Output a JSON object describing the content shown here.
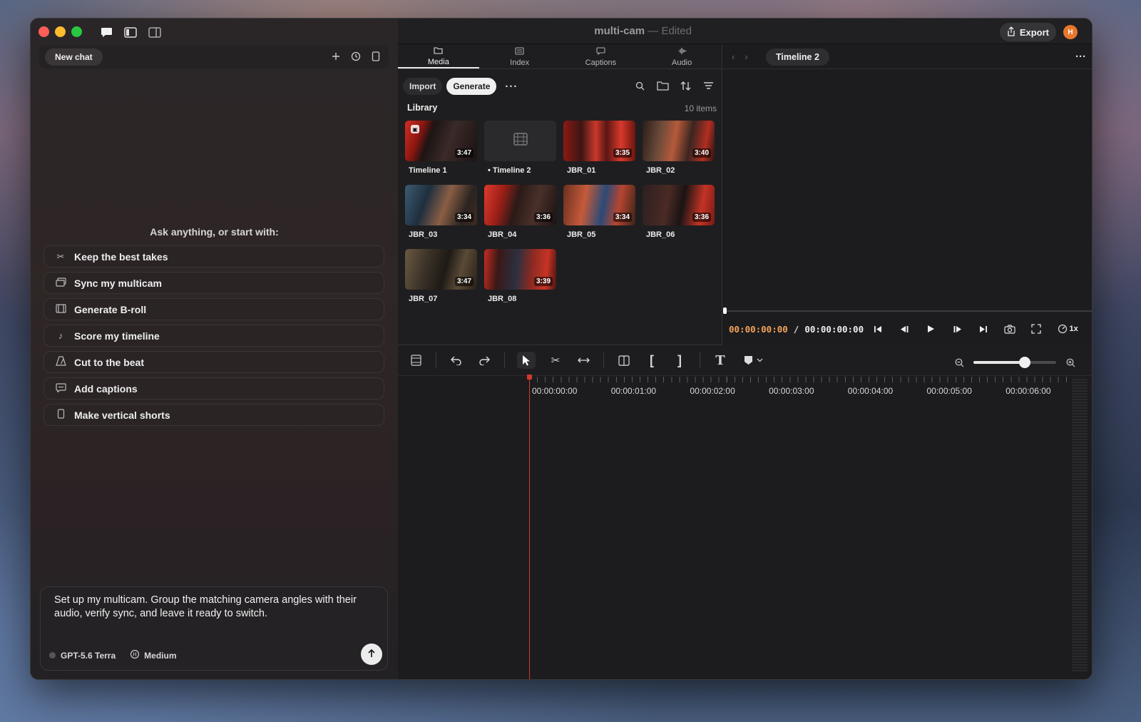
{
  "window": {
    "title": "multi-cam",
    "title_sep": " — ",
    "title_state": "Edited",
    "export_label": "Export",
    "avatar_initial": "H"
  },
  "chat": {
    "new_chat_label": "New chat",
    "prompt_heading": "Ask anything, or start with:",
    "suggestions": [
      {
        "label": "Keep the best takes",
        "icon": "scissors-icon"
      },
      {
        "label": "Sync my multicam",
        "icon": "layers-icon"
      },
      {
        "label": "Generate B-roll",
        "icon": "film-icon"
      },
      {
        "label": "Score my timeline",
        "icon": "music-note-icon"
      },
      {
        "label": "Cut to the beat",
        "icon": "metronome-icon"
      },
      {
        "label": "Add captions",
        "icon": "caption-icon"
      },
      {
        "label": "Make vertical shorts",
        "icon": "phone-icon"
      }
    ],
    "composer_text": "Set up my multicam. Group the matching camera angles with their audio, verify sync, and leave it ready to switch.",
    "model": "GPT-5.6 Terra",
    "effort": "Medium"
  },
  "media": {
    "tabs": [
      {
        "label": "Media",
        "active": true
      },
      {
        "label": "Index",
        "active": false
      },
      {
        "label": "Captions",
        "active": false
      },
      {
        "label": "Audio",
        "active": false
      }
    ],
    "import_label": "Import",
    "generate_label": "Generate",
    "more_label": "···",
    "library_label": "Library",
    "item_count": "10 items",
    "items": [
      {
        "name": "Timeline 1",
        "duration": "3:47",
        "style": "t-red",
        "locked": true
      },
      {
        "name": "• Timeline 2",
        "duration": "",
        "style": "t-blank",
        "locked": false
      },
      {
        "name": "JBR_01",
        "duration": "3:35",
        "style": "t-stage1",
        "locked": false
      },
      {
        "name": "JBR_02",
        "duration": "3:40",
        "style": "t-stage2",
        "locked": false
      },
      {
        "name": "JBR_03",
        "duration": "3:34",
        "style": "t-drums",
        "locked": false
      },
      {
        "name": "JBR_04",
        "duration": "3:36",
        "style": "t-red2",
        "locked": false
      },
      {
        "name": "JBR_05",
        "duration": "3:34",
        "style": "t-singer",
        "locked": false
      },
      {
        "name": "JBR_06",
        "duration": "3:36",
        "style": "t-guitar",
        "locked": false
      },
      {
        "name": "JBR_07",
        "duration": "3:47",
        "style": "t-drum2",
        "locked": false
      },
      {
        "name": "JBR_08",
        "duration": "3:39",
        "style": "t-band",
        "locked": false
      }
    ]
  },
  "viewer": {
    "timeline_name": "Timeline 2",
    "current_time": "00:00:00:00",
    "separator": "/",
    "total_time": "00:00:00:00",
    "speed": "1x"
  },
  "timeline": {
    "ruler_labels": [
      "00:00:00:00",
      "00:00:01:00",
      "00:00:02:00",
      "00:00:03:00",
      "00:00:04:00",
      "00:00:05:00",
      "00:00:06:00"
    ],
    "zoom_level": 0.62
  },
  "colors": {
    "accent_timecode": "#f5a35a",
    "playhead": "#d23a2e",
    "avatar": "#e8772e"
  }
}
